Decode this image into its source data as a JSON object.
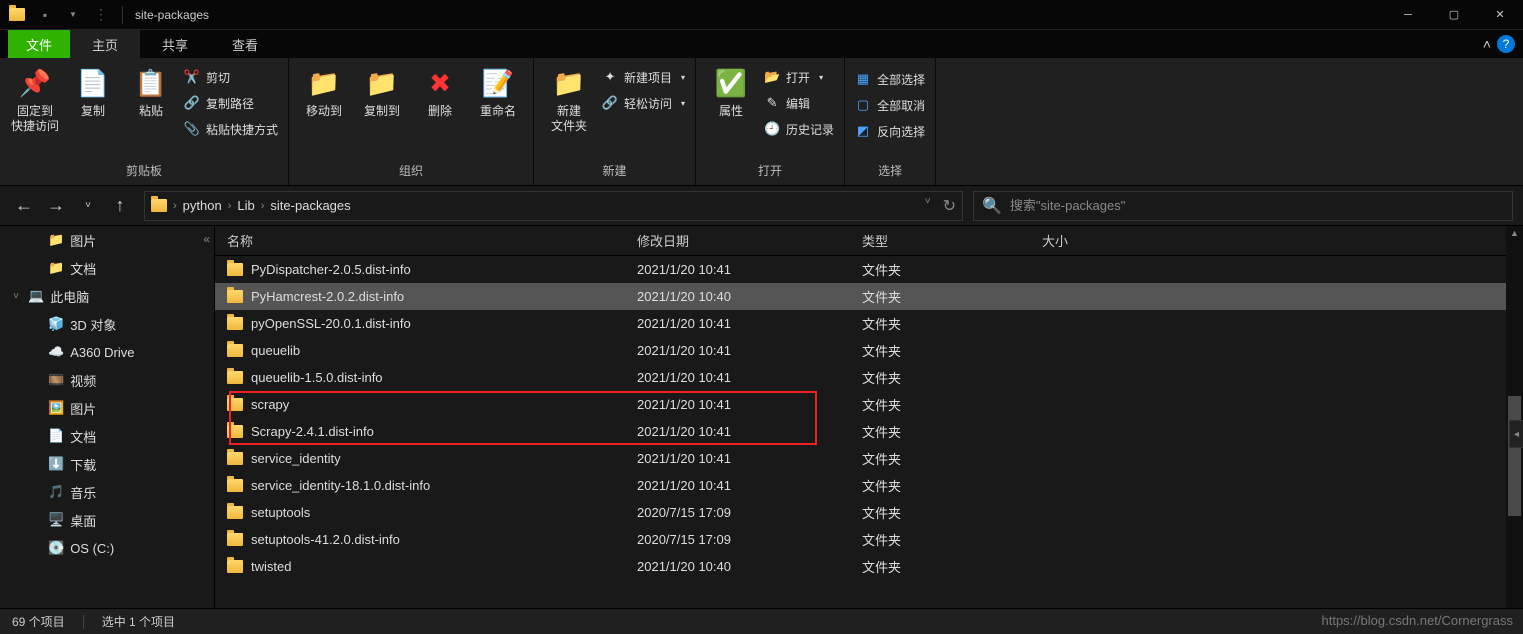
{
  "title": "site-packages",
  "tabs": {
    "file": "文件",
    "home": "主页",
    "share": "共享",
    "view": "查看"
  },
  "ribbon": {
    "clipboard": {
      "pin": "固定到\n快捷访问",
      "copy": "复制",
      "paste": "粘贴",
      "cut": "剪切",
      "copypath": "复制路径",
      "pasteshortcut": "粘贴快捷方式",
      "label": "剪贴板"
    },
    "organize": {
      "moveto": "移动到",
      "copyto": "复制到",
      "delete": "删除",
      "rename": "重命名",
      "label": "组织"
    },
    "new": {
      "newfolder": "新建\n文件夹",
      "newitem": "新建项目",
      "easyaccess": "轻松访问",
      "label": "新建"
    },
    "open": {
      "properties": "属性",
      "open": "打开",
      "edit": "编辑",
      "history": "历史记录",
      "label": "打开"
    },
    "select": {
      "all": "全部选择",
      "none": "全部取消",
      "invert": "反向选择",
      "label": "选择"
    }
  },
  "breadcrumb": [
    "python",
    "Lib",
    "site-packages"
  ],
  "search": {
    "placeholder": "搜索\"site-packages\""
  },
  "tree": [
    {
      "label": "图片",
      "icon": "folder",
      "indent": "sub"
    },
    {
      "label": "文档",
      "icon": "folder",
      "indent": "sub"
    },
    {
      "label": "此电脑",
      "icon": "pc",
      "indent": "root",
      "expanded": true
    },
    {
      "label": "3D 对象",
      "icon": "3d",
      "indent": "sub"
    },
    {
      "label": "A360 Drive",
      "icon": "cloud",
      "indent": "sub"
    },
    {
      "label": "视频",
      "icon": "video",
      "indent": "sub"
    },
    {
      "label": "图片",
      "icon": "pictures",
      "indent": "sub"
    },
    {
      "label": "文档",
      "icon": "docs",
      "indent": "sub"
    },
    {
      "label": "下载",
      "icon": "download",
      "indent": "sub"
    },
    {
      "label": "音乐",
      "icon": "music",
      "indent": "sub"
    },
    {
      "label": "桌面",
      "icon": "desktop",
      "indent": "sub"
    },
    {
      "label": "OS (C:)",
      "icon": "disk",
      "indent": "sub"
    }
  ],
  "columns": {
    "name": "名称",
    "date": "修改日期",
    "type": "类型",
    "size": "大小"
  },
  "rows": [
    {
      "name": "PyDispatcher-2.0.5.dist-info",
      "date": "2021/1/20 10:41",
      "type": "文件夹"
    },
    {
      "name": "PyHamcrest-2.0.2.dist-info",
      "date": "2021/1/20 10:40",
      "type": "文件夹",
      "selected": true
    },
    {
      "name": "pyOpenSSL-20.0.1.dist-info",
      "date": "2021/1/20 10:41",
      "type": "文件夹"
    },
    {
      "name": "queuelib",
      "date": "2021/1/20 10:41",
      "type": "文件夹"
    },
    {
      "name": "queuelib-1.5.0.dist-info",
      "date": "2021/1/20 10:41",
      "type": "文件夹"
    },
    {
      "name": "scrapy",
      "date": "2021/1/20 10:41",
      "type": "文件夹",
      "highlight": true
    },
    {
      "name": "Scrapy-2.4.1.dist-info",
      "date": "2021/1/20 10:41",
      "type": "文件夹",
      "highlight": true
    },
    {
      "name": "service_identity",
      "date": "2021/1/20 10:41",
      "type": "文件夹"
    },
    {
      "name": "service_identity-18.1.0.dist-info",
      "date": "2021/1/20 10:41",
      "type": "文件夹"
    },
    {
      "name": "setuptools",
      "date": "2020/7/15 17:09",
      "type": "文件夹"
    },
    {
      "name": "setuptools-41.2.0.dist-info",
      "date": "2020/7/15 17:09",
      "type": "文件夹"
    },
    {
      "name": "twisted",
      "date": "2021/1/20 10:40",
      "type": "文件夹"
    }
  ],
  "status": {
    "count": "69 个项目",
    "selected": "选中 1 个项目"
  },
  "watermark": "https://blog.csdn.net/Cornergrass"
}
